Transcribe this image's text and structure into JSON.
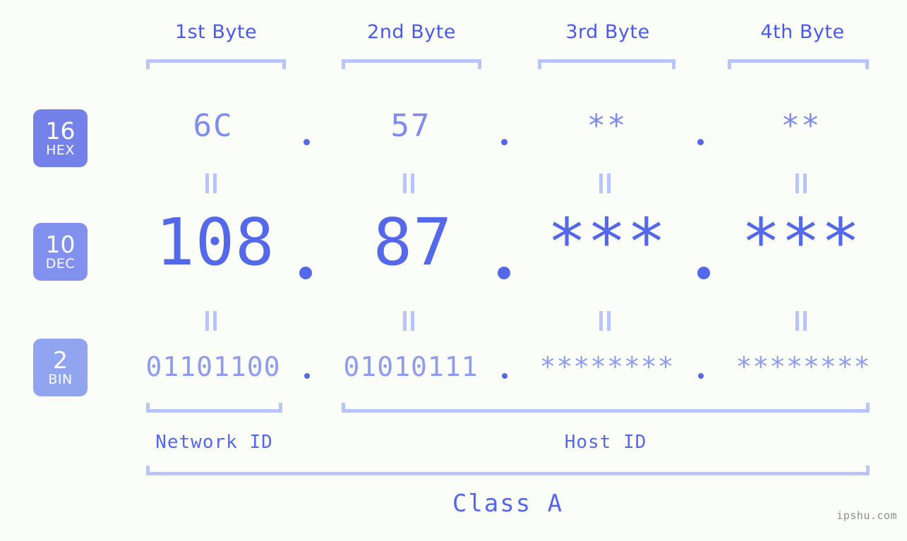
{
  "meta": {
    "background": "#fbfdf8",
    "accent": "#5468ea",
    "accent_light": "#b9c4fa",
    "watermark": "ipshu.com"
  },
  "headers": [
    {
      "label": "1st Byte"
    },
    {
      "label": "2nd Byte"
    },
    {
      "label": "3rd Byte"
    },
    {
      "label": "4th Byte"
    }
  ],
  "bases": [
    {
      "number": "16",
      "abbr": "HEX",
      "color": "#7481e8"
    },
    {
      "number": "10",
      "abbr": "DEC",
      "color": "#8290ee"
    },
    {
      "number": "2",
      "abbr": "BIN",
      "color": "#90a4f0"
    }
  ],
  "rows": {
    "hex": {
      "values": [
        "6C",
        "57",
        "**",
        "**"
      ],
      "separator": "."
    },
    "dec": {
      "values": [
        "108",
        "87",
        "***",
        "***"
      ],
      "separator": "."
    },
    "bin": {
      "values": [
        "01101100",
        "01010111",
        "********",
        "********"
      ],
      "separator": "."
    }
  },
  "equals_symbol": "=",
  "segments": {
    "network": {
      "label": "Network ID"
    },
    "host": {
      "label": "Host ID"
    }
  },
  "class": {
    "label": "Class A"
  }
}
